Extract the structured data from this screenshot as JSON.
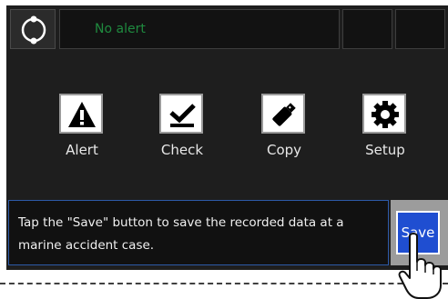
{
  "status": {
    "alert_text": "No alert"
  },
  "menu": [
    {
      "label": "Alert",
      "icon": "warning-icon"
    },
    {
      "label": "Check",
      "icon": "checkmark-icon"
    },
    {
      "label": "Copy",
      "icon": "usb-drive-icon"
    },
    {
      "label": "Setup",
      "icon": "gear-icon"
    }
  ],
  "message": {
    "text": "Tap the \"Save\" button to save the recorded data at a marine accident case."
  },
  "save_button": {
    "label": "Save"
  },
  "colors": {
    "screen_bg": "#1e1e1e",
    "alert_text": "#1f8a3f",
    "save_button": "#1f4ed1",
    "message_border": "#2d5aa8"
  }
}
